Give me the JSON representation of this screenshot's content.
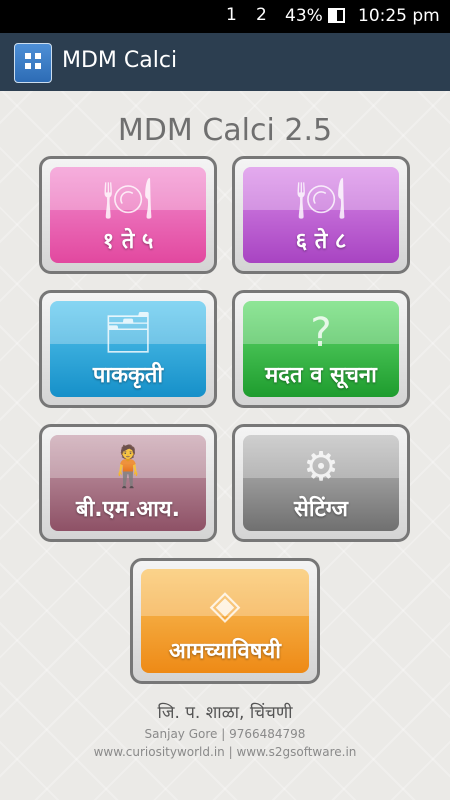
{
  "status_bar": {
    "sim1": "1",
    "sim2": "2",
    "battery_percent": "43%",
    "time": "10:25 pm"
  },
  "action_bar": {
    "title": "MDM Calci"
  },
  "heading": "MDM Calci 2.5",
  "tiles": [
    {
      "label": "१ ते ५",
      "icon": "plate-cutlery-icon",
      "color": "#e2489f"
    },
    {
      "label": "६ ते ८",
      "icon": "plate-cutlery-icon",
      "color": "#a844c2"
    },
    {
      "label": "पाककृती",
      "icon": "recipe-folder-icon",
      "color": "#1690c9"
    },
    {
      "label": "मदत व सूचना",
      "icon": "help-question-icon",
      "color": "#1e9c2e"
    },
    {
      "label": "बी.एम.आय.",
      "icon": "person-calculator-icon",
      "color": "#8e5166"
    },
    {
      "label": "सेटिंग्ज",
      "icon": "gears-icon",
      "color": "#707070"
    },
    {
      "label": "आमच्याविषयी",
      "icon": "diamond-logo-icon",
      "color": "#ee8a16"
    }
  ],
  "footer": {
    "school": "जि. प. शाळा, चिंचणी",
    "author": "Sanjay Gore | 9766484798",
    "websites": "www.curiosityworld.in | www.s2gsoftware.in"
  }
}
